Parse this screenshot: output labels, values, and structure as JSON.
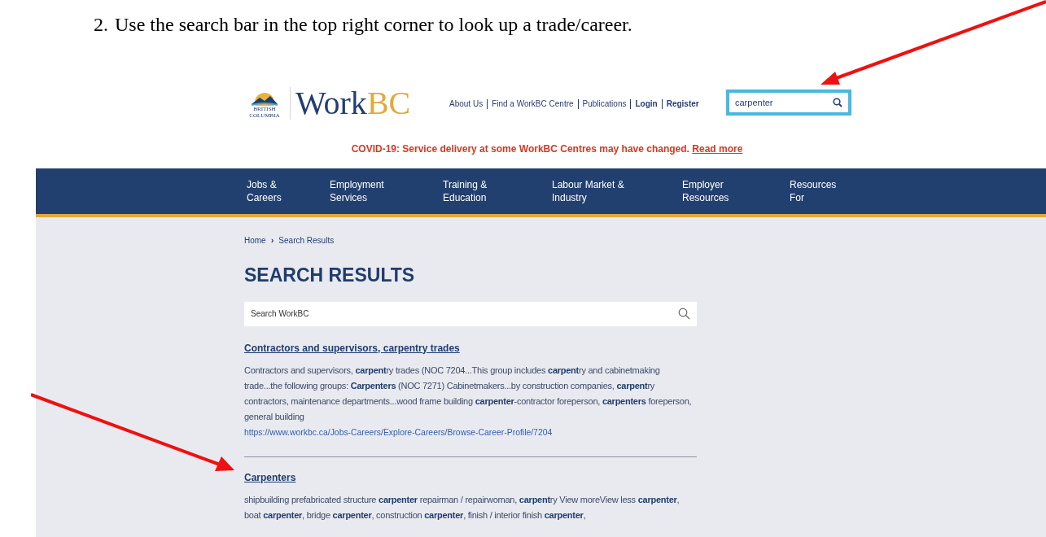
{
  "instruction": {
    "number": "2.",
    "text": "Use the search bar in the top right corner to look up a trade/career."
  },
  "header": {
    "logo_lines": [
      "BRITISH",
      "COLUMBIA"
    ],
    "brand": [
      "Work",
      "BC"
    ],
    "links": [
      {
        "label": "About Us",
        "bold": false
      },
      {
        "label": "Find a WorkBC Centre",
        "bold": false
      },
      {
        "label": "Publications",
        "bold": false
      },
      {
        "label": "Login",
        "bold": true
      },
      {
        "label": "Register",
        "bold": true
      }
    ],
    "search": {
      "value": "carpenter",
      "highlighted": true
    }
  },
  "alert": {
    "text": "COVID-19: Service delivery at some WorkBC Centres may have changed.",
    "link": "Read more"
  },
  "nav": [
    {
      "lines": [
        "Jobs &",
        "Careers"
      ]
    },
    {
      "lines": [
        "Employment",
        "Services"
      ]
    },
    {
      "lines": [
        "Training &",
        "Education"
      ]
    },
    {
      "lines": [
        "Labour Market &",
        "Industry"
      ]
    },
    {
      "lines": [
        "Employer",
        "Resources"
      ]
    },
    {
      "lines": [
        "Resources",
        "For"
      ]
    }
  ],
  "breadcrumb": [
    "Home",
    "›",
    "Search Results"
  ],
  "title": "SEARCH RESULTS",
  "search": {
    "placeholder": "Search WorkBC"
  },
  "results": [
    {
      "title": "Contractors and supervisors, carpentry trades",
      "snippet": "Contractors and supervisors, **carpent**ry trades (NOC 7204...This group includes **carpent**ry and cabinetmaking trade...the following groups: **Carpenters** (NOC 7271) Cabinetmakers...by construction companies, **carpent**ry contractors, maintenance departments...wood frame building **carpenter**-contractor foreperson, **carpenters** foreperson, general building",
      "url": "https://www.workbc.ca/Jobs-Careers/Explore-Careers/Browse-Career-Profile/7204"
    },
    {
      "title": "Carpenters",
      "snippet": "shipbuilding prefabricated structure **carpenter** repairman / repairwoman, **carpent**ry View moreView less **carpenter**, boat **carpenter**, bridge **carpenter**, construction **carpenter**, finish / interior finish **carpenter**,"
    }
  ]
}
